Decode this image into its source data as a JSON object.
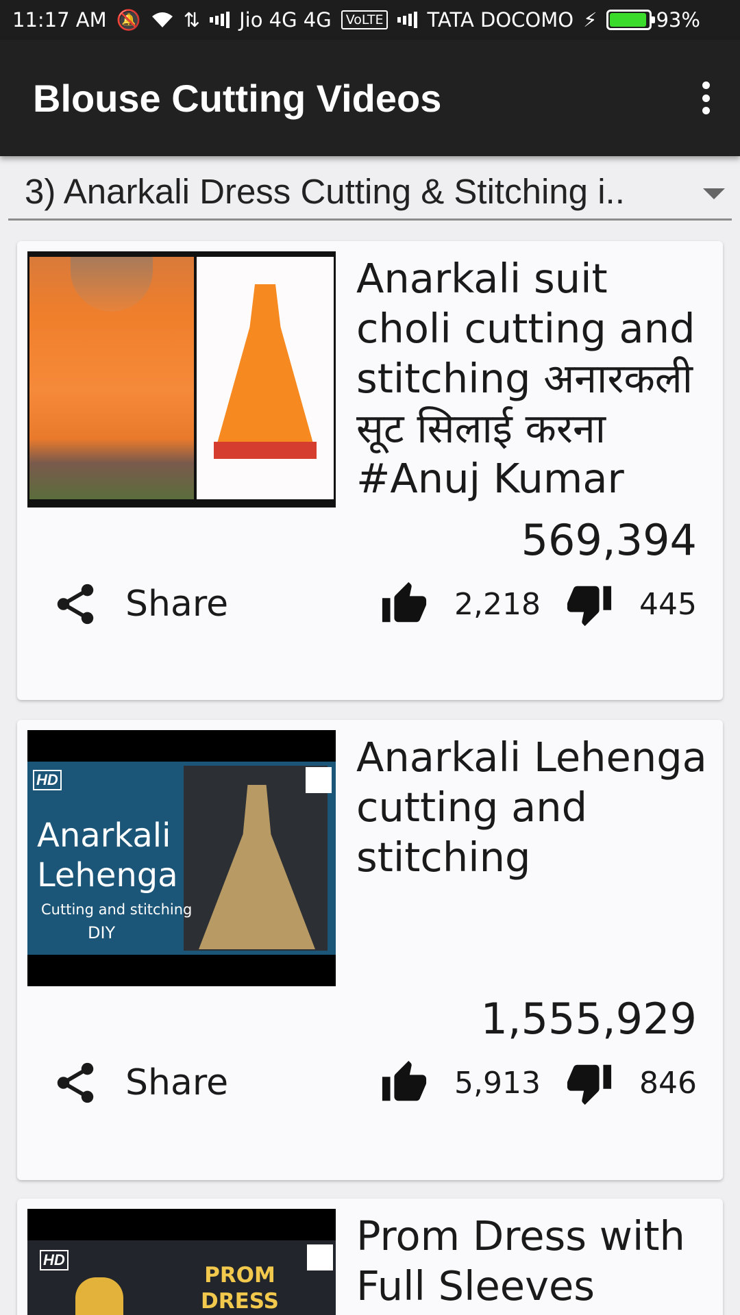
{
  "status_bar": {
    "time": "11:17 AM",
    "carrier1": "Jio 4G 4G",
    "volte": "VoLTE",
    "carrier2": "TATA DOCOMO",
    "battery": "93%",
    "battery_level": 0.93
  },
  "app_bar": {
    "title": "Blouse Cutting Videos",
    "overflow_icon": "more-vert-icon"
  },
  "playlist_spinner": {
    "selected": "3) Anarkali Dress Cutting & Stitching i.."
  },
  "videos": [
    {
      "title": "Anarkali suit choli cutting and stitching अनारकली सूट सिलाई करना #Anuj Kumar",
      "views": "569,394",
      "share_label": "Share",
      "likes": "2,218",
      "dislikes": "445"
    },
    {
      "title": "Anarkali Lehenga cutting and stitching",
      "views": "1,555,929",
      "share_label": "Share",
      "likes": "5,913",
      "dislikes": "846",
      "thumb_text": {
        "badge": "HD",
        "headline": "Anarkali\nLehenga",
        "sub": "Cutting and stitching",
        "tag": "DIY"
      }
    },
    {
      "title": "Prom Dress with Full Sleeves",
      "thumb_text": {
        "badge": "HD",
        "headline": "PROM DRESS WITH"
      }
    }
  ]
}
